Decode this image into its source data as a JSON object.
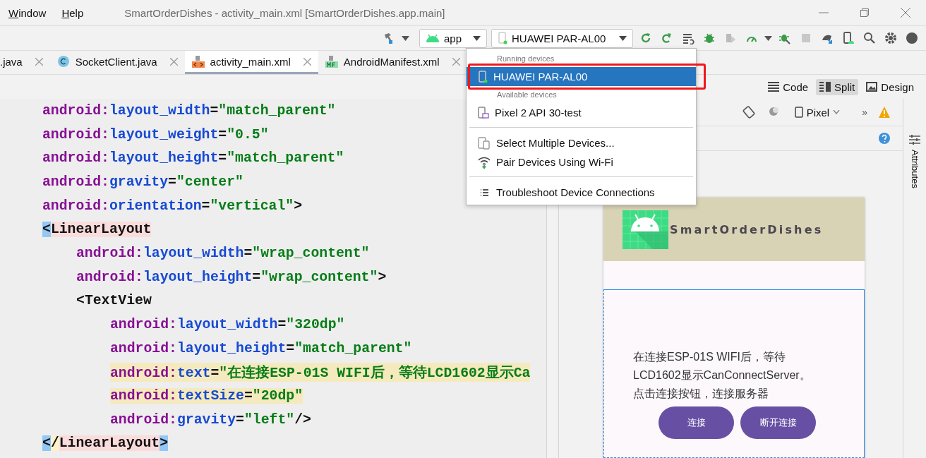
{
  "menu": [
    {
      "label": "Window"
    },
    {
      "label": "Help"
    }
  ],
  "window": {
    "title": "SmartOrderDishes - activity_main.xml [SmartOrderDishes.app.main]"
  },
  "toolbar": {
    "configuration": "app",
    "device": "HUAWEI PAR-AL00"
  },
  "tabs": [
    {
      "label": ".java",
      "kind": "plain",
      "selected": false
    },
    {
      "label": "SocketClient.java",
      "kind": "class",
      "selected": false
    },
    {
      "label": "activity_main.xml",
      "kind": "xml",
      "selected": true
    },
    {
      "label": "AndroidManifest.xml",
      "kind": "manifest",
      "selected": false
    }
  ],
  "view_modes": [
    {
      "label": "Code",
      "selected": false
    },
    {
      "label": "Split",
      "selected": true
    },
    {
      "label": "Design",
      "selected": false
    }
  ],
  "preview_toolbar": {
    "device": "Pixel",
    "overflow": "»"
  },
  "side_panel": {
    "label": "Attributes"
  },
  "code_lines": [
    {
      "highlighted": false,
      "current": false,
      "tokens": [
        {
          "kind": "ns",
          "text": "android:"
        },
        {
          "kind": "attr",
          "text": "layout_width"
        },
        {
          "kind": "punct",
          "text": "="
        },
        {
          "kind": "value",
          "text": "\"match_parent\""
        }
      ]
    },
    {
      "highlighted": false,
      "current": false,
      "tokens": [
        {
          "kind": "ns",
          "text": "android:"
        },
        {
          "kind": "attr",
          "text": "layout_weight"
        },
        {
          "kind": "punct",
          "text": "="
        },
        {
          "kind": "value",
          "text": "\"0.5\""
        }
      ]
    },
    {
      "highlighted": false,
      "current": false,
      "tokens": [
        {
          "kind": "ns",
          "text": "android:"
        },
        {
          "kind": "attr",
          "text": "layout_height"
        },
        {
          "kind": "punct",
          "text": "="
        },
        {
          "kind": "value",
          "text": "\"match_parent\""
        }
      ]
    },
    {
      "highlighted": false,
      "current": false,
      "tokens": [
        {
          "kind": "ns",
          "text": "android:"
        },
        {
          "kind": "attr",
          "text": "gravity"
        },
        {
          "kind": "punct",
          "text": "="
        },
        {
          "kind": "value",
          "text": "\"center\""
        }
      ]
    },
    {
      "highlighted": false,
      "current": false,
      "tokens": [
        {
          "kind": "ns",
          "text": "android:"
        },
        {
          "kind": "attr",
          "text": "orientation"
        },
        {
          "kind": "punct",
          "text": "="
        },
        {
          "kind": "value",
          "text": "\"vertical\""
        },
        {
          "kind": "punct",
          "text": ">"
        }
      ]
    },
    {
      "highlighted": false,
      "current": false,
      "tokens": [
        {
          "kind": "bracket",
          "text": "<"
        },
        {
          "kind": "matched_tag",
          "text": "LinearLayout"
        }
      ],
      "children": [
        {
          "highlighted": false,
          "current": false,
          "tokens": [
            {
              "kind": "ns",
              "text": "android:"
            },
            {
              "kind": "attr",
              "text": "layout_width"
            },
            {
              "kind": "punct",
              "text": "="
            },
            {
              "kind": "value",
              "text": "\"wrap_content\""
            }
          ]
        },
        {
          "highlighted": false,
          "current": false,
          "tokens": [
            {
              "kind": "ns",
              "text": "android:"
            },
            {
              "kind": "attr",
              "text": "layout_height"
            },
            {
              "kind": "punct",
              "text": "="
            },
            {
              "kind": "value",
              "text": "\"wrap_content\""
            },
            {
              "kind": "punct",
              "text": ">"
            }
          ]
        },
        {
          "highlighted": false,
          "current": false,
          "tokens": [
            {
              "kind": "punct",
              "text": "<"
            },
            {
              "kind": "tag",
              "text": "TextView"
            }
          ],
          "children": [
            {
              "highlighted": false,
              "current": false,
              "tokens": [
                {
                  "kind": "ns",
                  "text": "android:"
                },
                {
                  "kind": "attr",
                  "text": "layout_width"
                },
                {
                  "kind": "punct",
                  "text": "="
                },
                {
                  "kind": "value",
                  "text": "\"320dp\""
                }
              ]
            },
            {
              "highlighted": false,
              "current": false,
              "tokens": [
                {
                  "kind": "ns",
                  "text": "android:"
                },
                {
                  "kind": "attr",
                  "text": "layout_height"
                },
                {
                  "kind": "punct",
                  "text": "="
                },
                {
                  "kind": "value",
                  "text": "\"match_parent\""
                }
              ]
            },
            {
              "highlighted": true,
              "current": false,
              "tokens": [
                {
                  "kind": "ns",
                  "text": "android:"
                },
                {
                  "kind": "attr",
                  "text": "text"
                },
                {
                  "kind": "punct",
                  "text": "="
                },
                {
                  "kind": "value",
                  "text": "\"在连接ESP-01S WIFI后，等待LCD1602显示Ca"
                }
              ]
            },
            {
              "highlighted": true,
              "current": false,
              "tokens": [
                {
                  "kind": "ns",
                  "text": "android:"
                },
                {
                  "kind": "attr",
                  "text": "textSize"
                },
                {
                  "kind": "punct",
                  "text": "="
                },
                {
                  "kind": "value",
                  "text": "\"20dp\""
                }
              ]
            },
            {
              "highlighted": false,
              "current": false,
              "tokens": [
                {
                  "kind": "ns",
                  "text": "android:"
                },
                {
                  "kind": "attr",
                  "text": "gravity"
                },
                {
                  "kind": "punct",
                  "text": "="
                },
                {
                  "kind": "value",
                  "text": "\"left\""
                },
                {
                  "kind": "punct",
                  "text": "/>"
                }
              ]
            }
          ]
        }
      ]
    },
    {
      "highlighted": false,
      "current": true,
      "tokens": [
        {
          "kind": "bracket",
          "text": "<"
        },
        {
          "kind": "punct",
          "text": "/"
        },
        {
          "kind": "matched_tag",
          "text": "LinearLayout"
        },
        {
          "kind": "bracket",
          "text": ">"
        }
      ]
    }
  ],
  "preview": {
    "app_title": "SmartOrderDishes",
    "message": [
      "在连接ESP-01S WIFI后，等待",
      "LCD1602显示CanConnectServer。",
      "点击连接按钮，连接服务器"
    ],
    "buttons": [
      "连接",
      "断开连接"
    ]
  },
  "device_menu": [
    {
      "kind": "header",
      "label": "Running devices"
    },
    {
      "kind": "device",
      "label": "HUAWEI PAR-AL00",
      "running": true,
      "selected": true,
      "outlined": true
    },
    {
      "kind": "header",
      "label": "Available devices"
    },
    {
      "kind": "device",
      "label": "Pixel 2 API 30-test",
      "running": false,
      "selected": false,
      "outlined": false
    },
    {
      "kind": "divider"
    },
    {
      "kind": "action",
      "label": "Select Multiple Devices..."
    },
    {
      "kind": "action",
      "label": "Pair Devices Using Wi-Fi"
    },
    {
      "kind": "divider"
    },
    {
      "kind": "action",
      "label": "Troubleshoot Device Connections"
    }
  ]
}
